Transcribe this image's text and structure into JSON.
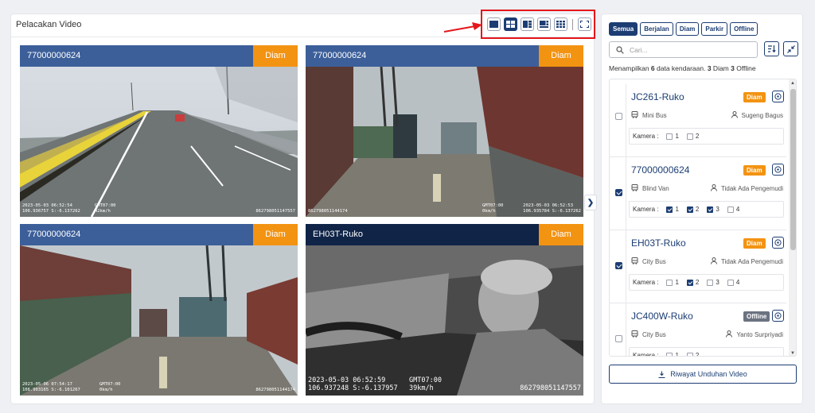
{
  "panel": {
    "title": "Pelacakan Video"
  },
  "layout_icons": [
    "single-view-icon",
    "grid-2x2-icon",
    "grid-1-plus-3-icon",
    "grid-1-plus-5-icon",
    "grid-3x3-icon",
    "fullscreen-icon"
  ],
  "tiles": [
    {
      "label": "77000000624",
      "status": "Diam",
      "osd": [
        "2023-05-03 06:52:54",
        "106.936757 S:-6.137262",
        "GMT07:00",
        "42km/h",
        "862798051147557"
      ]
    },
    {
      "label": "77000000624",
      "status": "Diam",
      "osd": [
        "2023-05-03 06:52:53",
        "106.935784 S:-6.137262",
        "GMT07:00",
        "0km/h",
        "862798051144174"
      ]
    },
    {
      "label": "77000000624",
      "status": "Diam",
      "osd": [
        "2023-05-06 07:54:17",
        "106.903165 S:-6.101267",
        "GMT07:00",
        "0km/h",
        "862798051144174"
      ]
    },
    {
      "label": "EH03T-Ruko",
      "status": "Diam",
      "osd": [
        "2023-05-03 06:52:59",
        "106.937248 S:-6.137957",
        "GMT07:00",
        "39km/h",
        "862798051147557"
      ]
    }
  ],
  "filters": [
    "Semua",
    "Berjalan",
    "Diam",
    "Parkir",
    "Offline"
  ],
  "search": {
    "placeholder": "Cari..."
  },
  "summary": {
    "prefix": "Menampilkan ",
    "total": "6",
    "mid": " data kendaraan. ",
    "diam": "3",
    "diam_label": " Diam ",
    "offline": "3",
    "offline_label": " Offline"
  },
  "camera_label": "Kamera :",
  "vehicles": [
    {
      "name": "JC261-Ruko",
      "badge": "Diam",
      "type": "Mini Bus",
      "driver": "Sugeng Bagus",
      "checked": false,
      "cameras": [
        {
          "n": "1",
          "on": false
        },
        {
          "n": "2",
          "on": false
        }
      ]
    },
    {
      "name": "77000000624",
      "badge": "Diam",
      "type": "Blind Van",
      "driver": "Tidak Ada Pengemudi",
      "checked": true,
      "cameras": [
        {
          "n": "1",
          "on": true
        },
        {
          "n": "2",
          "on": true
        },
        {
          "n": "3",
          "on": true
        },
        {
          "n": "4",
          "on": false
        }
      ]
    },
    {
      "name": "EH03T-Ruko",
      "badge": "Diam",
      "type": "City Bus",
      "driver": "Tidak Ada Pengemudi",
      "checked": true,
      "cameras": [
        {
          "n": "1",
          "on": false
        },
        {
          "n": "2",
          "on": true
        },
        {
          "n": "3",
          "on": false
        },
        {
          "n": "4",
          "on": false
        }
      ]
    },
    {
      "name": "JC400W-Ruko",
      "badge": "Offline",
      "type": "City Bus",
      "driver": "Yanto Surpriyadi",
      "checked": false,
      "cameras": [
        {
          "n": "1",
          "on": false
        },
        {
          "n": "2",
          "on": false
        }
      ]
    }
  ],
  "download_button": "Riwayat Unduhan Video",
  "colors": {
    "navy": "#1c3d73",
    "header_blue": "#3c5f9a",
    "header_dark": "#0f2447",
    "status_orange": "#f39312",
    "highlight_red": "#e4161b",
    "offline_gray": "#6b7280"
  }
}
